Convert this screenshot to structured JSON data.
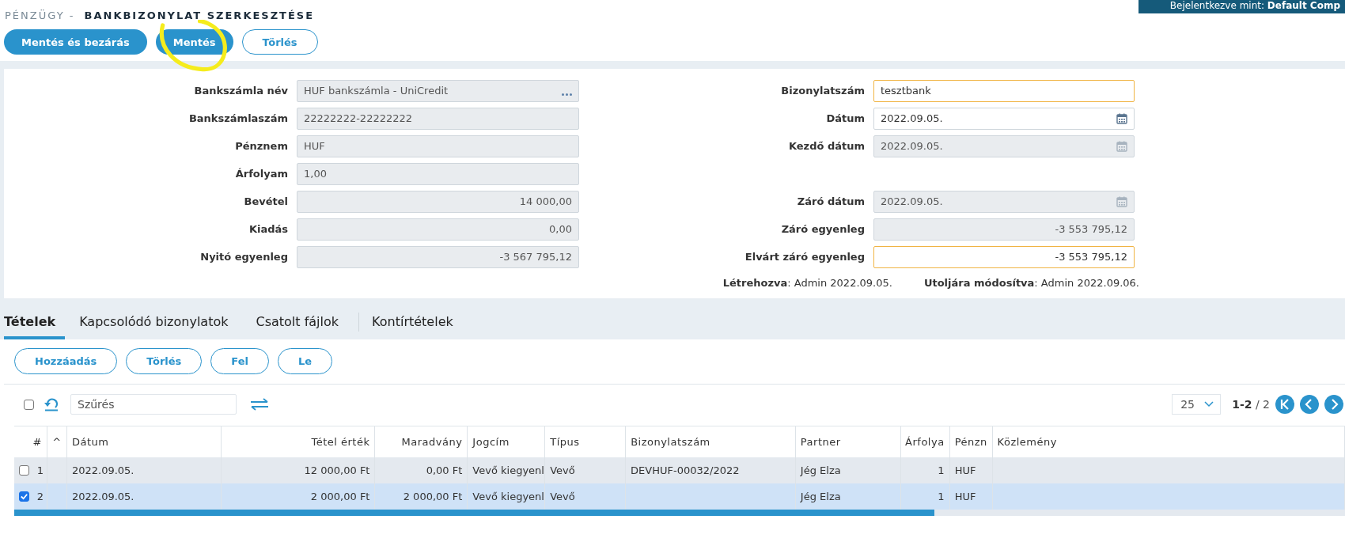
{
  "header": {
    "section": "PÉNZÜGY -",
    "title": "BANKBIZONYLAT SZERKESZTÉSE",
    "login_label": "Bejelentkezve mint:",
    "login_user": "Default Comp"
  },
  "actions": [
    {
      "label": "Mentés és bezárás",
      "kind": "primary",
      "circled": false
    },
    {
      "label": "Mentés",
      "kind": "primary",
      "circled": true
    },
    {
      "label": "Törlés",
      "kind": "outline",
      "circled": false
    }
  ],
  "form": {
    "left": [
      {
        "label": "Bankszámla név",
        "value": "HUF bankszámla - UniCredit",
        "kind": "lookup",
        "editable": false,
        "required": false
      },
      {
        "label": "Bankszámlaszám",
        "value": "22222222-22222222",
        "kind": "text",
        "editable": false,
        "required": false
      },
      {
        "label": "Pénznem",
        "value": "HUF",
        "kind": "text",
        "editable": false,
        "required": false
      },
      {
        "label": "Árfolyam",
        "value": "1,00",
        "kind": "text",
        "editable": false,
        "required": false
      },
      {
        "label": "Bevétel",
        "value": "14 000,00",
        "kind": "amount",
        "editable": false,
        "required": false
      },
      {
        "label": "Kiadás",
        "value": "0,00",
        "kind": "amount",
        "editable": false,
        "required": false
      },
      {
        "label": "Nyitó egyenleg",
        "value": "-3 567 795,12",
        "kind": "amount",
        "editable": false,
        "required": false
      }
    ],
    "right": [
      {
        "label": "Bizonylatszám",
        "value": "tesztbank",
        "kind": "text",
        "editable": true,
        "required": true
      },
      {
        "label": "Dátum",
        "value": "2022.09.05.",
        "kind": "date",
        "editable": true,
        "required": false
      },
      {
        "label": "Kezdő dátum",
        "value": "2022.09.05.",
        "kind": "date",
        "editable": false,
        "required": false
      },
      {
        "kind": "blank"
      },
      {
        "label": "Záró dátum",
        "value": "2022.09.05.",
        "kind": "date",
        "editable": false,
        "required": false
      },
      {
        "label": "Záró egyenleg",
        "value": "-3 553 795,12",
        "kind": "amount",
        "editable": false,
        "required": false
      },
      {
        "label": "Elvárt záró egyenleg",
        "value": "-3 553 795,12",
        "kind": "amount",
        "editable": true,
        "required": true
      }
    ],
    "created_label": "Létrehozva",
    "created_value": ": Admin 2022.09.05.",
    "modified_label": "Utoljára módosítva",
    "modified_value": ": Admin 2022.09.06."
  },
  "tabs": [
    {
      "label": "Tételek",
      "selected": true
    },
    {
      "label": "Kapcsolódó bizonylatok",
      "selected": false
    },
    {
      "label": "Csatolt fájlok",
      "selected": false
    },
    {
      "label": "Kontírtételek",
      "selected": false
    }
  ],
  "item_actions": [
    "Hozzáadás",
    "Törlés",
    "Fel",
    "Le"
  ],
  "toolbar": {
    "select_all": false,
    "filter_placeholder": "Szűrés",
    "page_size": "25",
    "range": "1-2",
    "total": "/ 2"
  },
  "table": {
    "columns": [
      "#",
      "^",
      "Dátum",
      "Tétel érték",
      "Maradvány",
      "Jogcím",
      "Típus",
      "Bizonylatszám",
      "Partner",
      "Árfolya",
      "Pénzn",
      "Közlemény"
    ],
    "rows": [
      {
        "checked": false,
        "selected": false,
        "cells": [
          "1",
          "",
          "2022.09.05.",
          "12 000,00 Ft",
          "0,00 Ft",
          "Vevő kiegyenl",
          "Vevő",
          "DEVHUF-00032/2022",
          "Jég Elza",
          "1",
          "HUF",
          ""
        ]
      },
      {
        "checked": true,
        "selected": true,
        "cells": [
          "2",
          "",
          "2022.09.05.",
          "2 000,00 Ft",
          "2 000,00 Ft",
          "Vevő kiegyenl",
          "Vevő",
          "",
          "Jég Elza",
          "1",
          "HUF",
          ""
        ]
      }
    ]
  }
}
